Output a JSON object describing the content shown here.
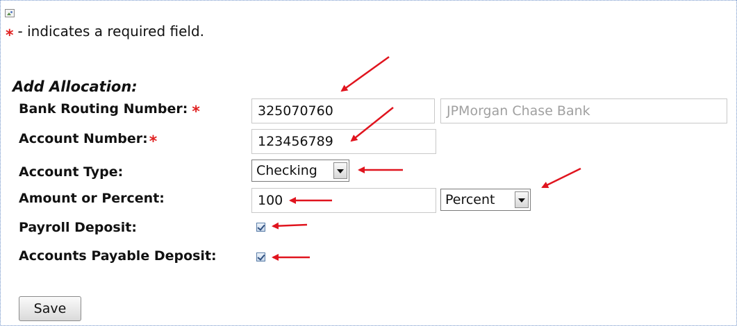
{
  "legend": {
    "required_marker": "*",
    "text": "- indicates a required field."
  },
  "form": {
    "title": "Add Allocation:",
    "routing": {
      "label": "Bank Routing Number:",
      "value": "325070760",
      "bank_name": "JPMorgan Chase Bank"
    },
    "account_number": {
      "label": "Account Number:",
      "value": "123456789"
    },
    "account_type": {
      "label": "Account Type:",
      "selected": "Checking"
    },
    "amount": {
      "label": "Amount or Percent:",
      "value": "100",
      "unit_selected": "Percent"
    },
    "payroll_deposit": {
      "label": "Payroll Deposit:",
      "checked": true
    },
    "ap_deposit": {
      "label": "Accounts Payable Deposit:",
      "checked": true
    },
    "save_label": "Save"
  },
  "colors": {
    "required": "#e02020",
    "annotation_arrow": "#e0141e",
    "frame_border": "#6b8fc7"
  }
}
